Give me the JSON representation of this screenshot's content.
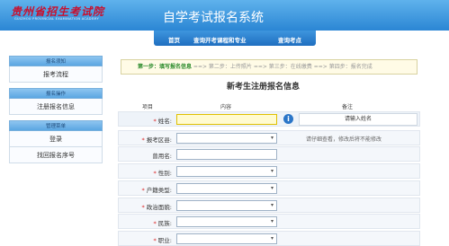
{
  "header": {
    "logo_text": "贵州省招生考试院",
    "logo_sub": "GUIZHOU PROVINCIAL EXAMINATION ACADEMY",
    "system_title": "自学考试报名系统"
  },
  "nav": {
    "items": [
      {
        "label": "首页"
      },
      {
        "label": "查询开考课程和专业"
      },
      {
        "label": "查询考点"
      }
    ]
  },
  "sidebar": {
    "blocks": [
      {
        "head": "报名须知",
        "links": [
          "报考流程"
        ]
      },
      {
        "head": "报名操作",
        "links": [
          "注册报名信息"
        ]
      },
      {
        "head": "管理菜单",
        "links": [
          "登录",
          "找回报名序号"
        ]
      }
    ]
  },
  "steps": {
    "active": "第一步：填写报名信息",
    "rest": " ==> 第二步：上传照片 ==> 第三步：在线缴费 ==> 第四步：报名完成"
  },
  "form": {
    "title": "新考生注册报名信息",
    "col_item": "项目",
    "col_content": "内容",
    "col_note": "备注",
    "rows": [
      {
        "label": "姓名:",
        "required": true,
        "type": "input",
        "value": "",
        "note": "请输入姓名"
      },
      {
        "label": "报考区县:",
        "required": true,
        "type": "select",
        "value": "",
        "note": "请仔细查看，修改后将不能修改"
      },
      {
        "label": "曾用名:",
        "required": false,
        "type": "input",
        "value": "",
        "note": ""
      },
      {
        "label": "性别:",
        "required": true,
        "type": "select",
        "value": "",
        "note": ""
      },
      {
        "label": "户籍类型:",
        "required": true,
        "type": "select",
        "value": "",
        "note": ""
      },
      {
        "label": "政治面貌:",
        "required": true,
        "type": "select",
        "value": "",
        "note": ""
      },
      {
        "label": "民族:",
        "required": true,
        "type": "select",
        "value": "",
        "note": ""
      },
      {
        "label": "职业:",
        "required": true,
        "type": "select",
        "value": "",
        "note": ""
      }
    ]
  },
  "colors": {
    "header_top": "#5fb2ec",
    "header_bottom": "#2b86d4",
    "step_active": "#2a8a2a",
    "required": "#dd2222"
  }
}
